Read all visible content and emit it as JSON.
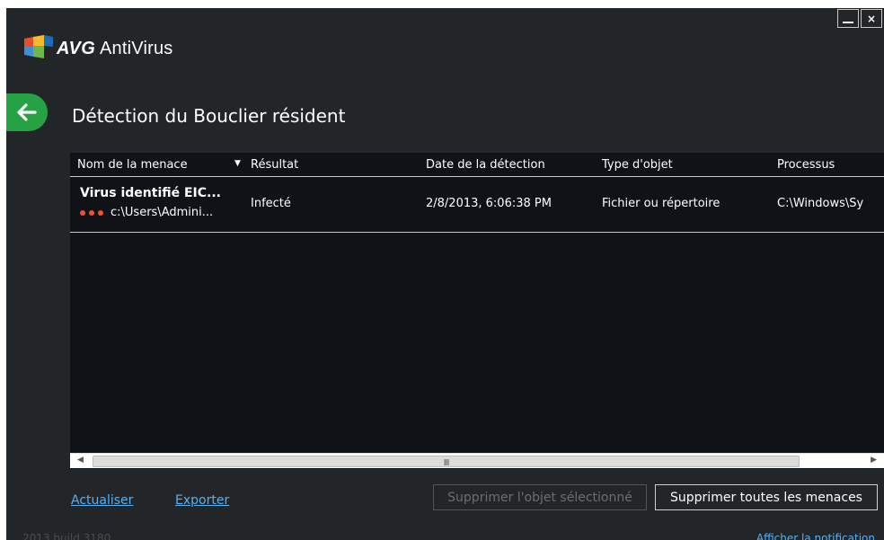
{
  "app": {
    "brand": "AVG",
    "product": "AntiVirus"
  },
  "window_controls": {
    "minimize_label": "",
    "close_label": "×"
  },
  "page": {
    "title": "Détection du Bouclier résident"
  },
  "table": {
    "columns": [
      "Nom de la menace",
      "Résultat",
      "Date de la détection",
      "Type d'objet",
      "Processus"
    ],
    "sort_column": "Nom de la menace",
    "rows": [
      {
        "threat_name": "Virus identifié EIC...",
        "path": "c:\\Users\\Admini...",
        "result": "Infecté",
        "date": "2/8/2013, 6:06:38 PM",
        "object_type": "Fichier ou répertoire",
        "process": "C:\\Windows\\Sy"
      }
    ]
  },
  "scrollbar": {
    "grip": "III"
  },
  "footer": {
    "refresh_link": "Actualiser",
    "export_link": "Exporter",
    "remove_selected": "Supprimer l'objet sélectionné",
    "remove_all": "Supprimer toutes les menaces",
    "version": "2013  build 3180",
    "show_notification": "Afficher la notification"
  },
  "colors": {
    "background": "#232629",
    "table_background": "#0f1217",
    "accent_green": "#26a143",
    "link": "#5ab0f0",
    "severity_dot": "#f0522d"
  },
  "icons": [
    "avg-logo",
    "back-arrow-icon",
    "minimize-icon",
    "close-icon",
    "sort-desc-icon",
    "severity-dots-icon",
    "scroll-left-icon",
    "scroll-right-icon"
  ]
}
